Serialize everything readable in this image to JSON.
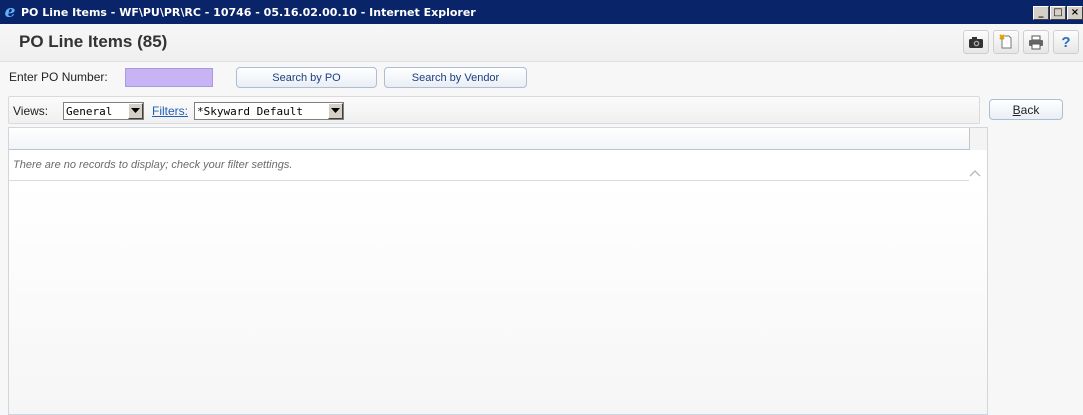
{
  "window": {
    "title": "PO Line Items - WF\\PU\\PR\\RC - 10746 - 05.16.02.00.10 - Internet Explorer",
    "controls": {
      "minimize": "_",
      "maximize": "□",
      "close": "×"
    }
  },
  "header": {
    "title": "PO Line Items (85)",
    "icons": [
      "camera-icon",
      "new-page-icon",
      "print-icon",
      "help-icon"
    ],
    "help_label": "?"
  },
  "search": {
    "label": "Enter PO Number:",
    "value": "",
    "search_by_po_label": "Search by PO",
    "search_by_vendor_label": "Search by Vendor"
  },
  "views": {
    "label": "Views:",
    "selected_view": "General",
    "filters_label": "Filters:",
    "selected_filter": "*Skyward Default"
  },
  "back_button": {
    "label_underlined": "B",
    "label_rest": "ack"
  },
  "grid": {
    "empty_message": "There are no records to display; check your filter settings."
  },
  "colors": {
    "titlebar": "#0a246a",
    "input_highlight": "#c8b3f5",
    "link": "#1f5fb5"
  }
}
